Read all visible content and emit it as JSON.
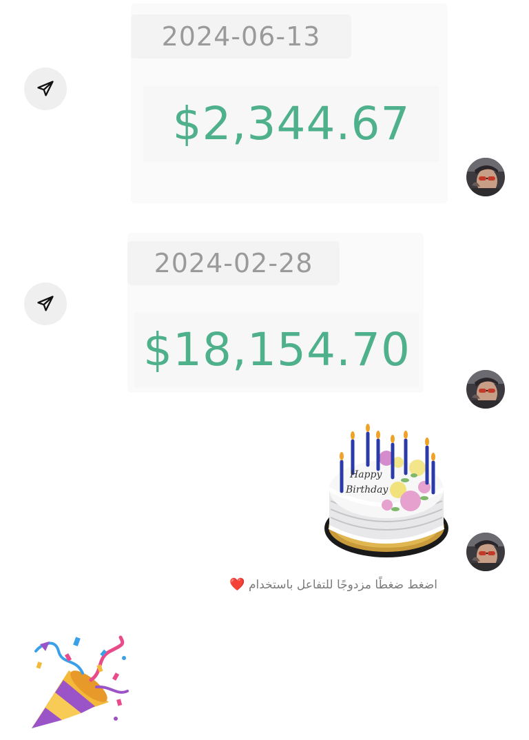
{
  "messages": [
    {
      "date": "2024-06-13",
      "amount": "$2,344.67"
    },
    {
      "date": "2024-02-28",
      "amount": "$18,154.70"
    }
  ],
  "cake": {
    "text_line1": "Happy",
    "text_line2": "Birthday"
  },
  "hint": {
    "text": "اضغط ضغطًا مزدوجًا للتفاعل باستخدام",
    "emoji": "❤️"
  },
  "icons": {
    "share": "send-icon",
    "avatar": "avatar",
    "party": "party-popper-icon"
  },
  "colors": {
    "amount": "#4fb08c",
    "date": "#9a9a9a",
    "chip_bg": "#f3f3f3",
    "share_bg": "#efefef",
    "heart": "#e0312b"
  }
}
